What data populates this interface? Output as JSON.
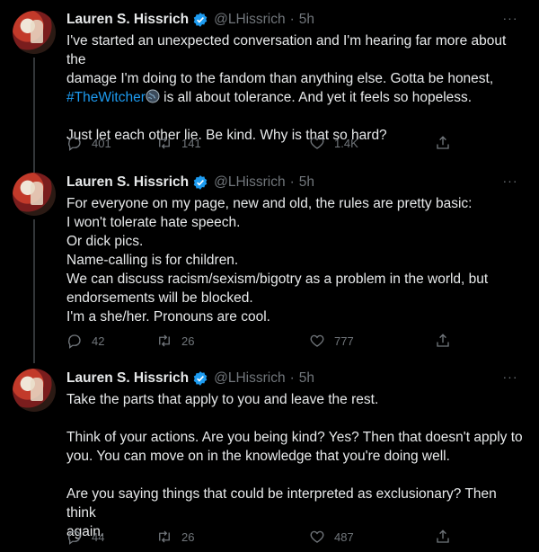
{
  "tweets": [
    {
      "name": "Lauren S. Hissrich",
      "handle": "@LHissrich",
      "separator": "·",
      "time": "5h",
      "more": "···",
      "lines": [
        "I've started an unexpected conversation and I'm hearing far more about the",
        "damage I'm doing to the fandom than anything else. Gotta be honest,"
      ],
      "hashtag": "#TheWitcher",
      "hashtag_tail": " is all about tolerance. And yet it feels so hopeless.",
      "after_gap": "Just let each other lie. Be kind. Why is that so hard?",
      "replies": "401",
      "retweets": "141",
      "likes": "1.4K"
    },
    {
      "name": "Lauren S. Hissrich",
      "handle": "@LHissrich",
      "separator": "·",
      "time": "5h",
      "more": "···",
      "lines": [
        "For everyone on my page, new and old, the rules are pretty basic:",
        "I won't tolerate hate speech.",
        "Or dick pics.",
        "Name-calling is for children.",
        "We can discuss racism/sexism/bigotry as a problem in the world, but",
        "endorsements will be blocked.",
        "I'm a she/her. Pronouns are cool."
      ],
      "replies": "42",
      "retweets": "26",
      "likes": "777"
    },
    {
      "name": "Lauren S. Hissrich",
      "handle": "@LHissrich",
      "separator": "·",
      "time": "5h",
      "more": "···",
      "p1": "Take the parts that apply to you and leave the rest.",
      "p2": [
        "Think of your actions. Are you being kind? Yes? Then that doesn't apply to",
        "you. You can move on in the knowledge that you're doing well."
      ],
      "p3": [
        "Are you saying things that could be interpreted as exclusionary? Then think",
        "again."
      ],
      "replies": "44",
      "retweets": "26",
      "likes": "487"
    }
  ],
  "colors": {
    "background": "#000000",
    "text": "#e7e9ea",
    "muted": "#71767b",
    "link": "#1d9bf0",
    "verified": "#1d9bf0"
  },
  "icons": [
    "avatar",
    "verified-badge-icon",
    "globe-emoji-icon",
    "more-icon",
    "reply-icon",
    "retweet-icon",
    "like-icon",
    "share-icon"
  ]
}
